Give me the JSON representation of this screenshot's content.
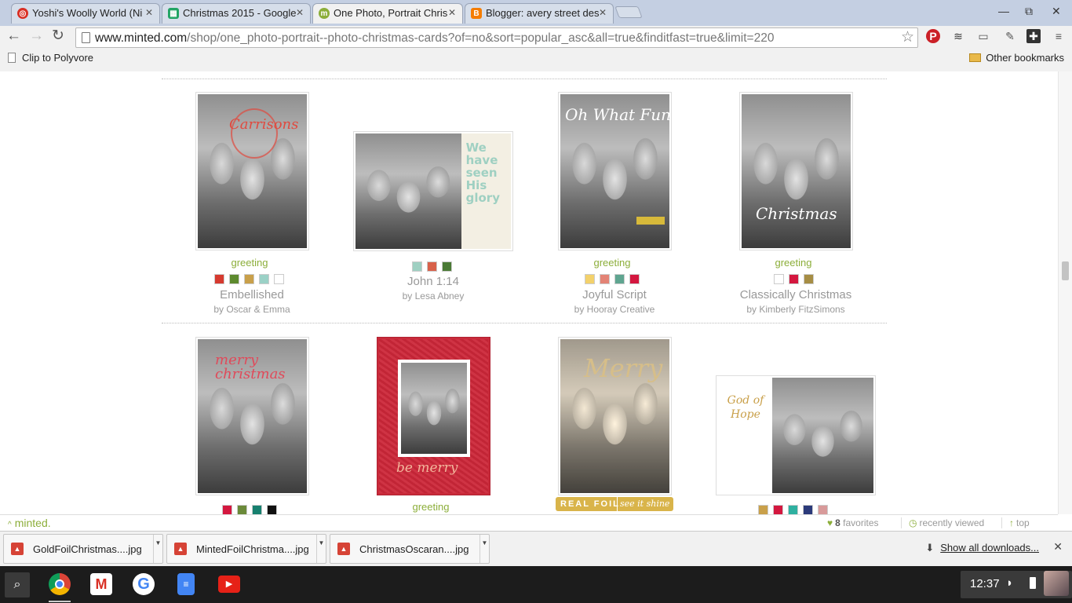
{
  "browser": {
    "tabs": [
      {
        "label": "Yoshi's Woolly World (Ni",
        "favicon_color": "#d93025",
        "favicon": "target-icon"
      },
      {
        "label": "Christmas 2015 - Google",
        "favicon_color": "#21a464",
        "favicon": "sheets-icon"
      },
      {
        "label": "One Photo, Portrait Chris",
        "favicon_color": "#8cae3a",
        "favicon": "minted-icon",
        "active": true
      },
      {
        "label": "Blogger: avery street des",
        "favicon_color": "#f57d00",
        "favicon": "blogger-icon"
      }
    ],
    "url_domain": "www.minted.com",
    "url_path": "/shop/one_photo-portrait--photo-christmas-cards?of=no&sort=popular_asc&all=true&finditfast=true&limit=220",
    "bookmarks": {
      "left": "Clip to Polyvore",
      "right": "Other bookmarks"
    }
  },
  "cards_row1": [
    {
      "label": "greeting",
      "title": "Embellished",
      "by": "by Oscar & Emma",
      "overlay": "Carrisons",
      "overlay_color": "#e04a3f",
      "swatches": [
        "#d63a2f",
        "#5d8a2e",
        "#c9a04a",
        "#9bd1c6",
        "#ffffff"
      ]
    },
    {
      "label": "",
      "title": "John 1:14",
      "by": "by Lesa Abney",
      "overlay": "We have seen His glory",
      "overlay_color": "#e06a55",
      "swatches": [
        "#9fd0c2",
        "#d8614a",
        "#4a7a35"
      ]
    },
    {
      "label": "greeting",
      "title": "Joyful Script",
      "by": "by Hooray Creative",
      "overlay": "Oh What Fun",
      "overlay_color": "#ffffff",
      "swatches": [
        "#f3d16b",
        "#e38375",
        "#5fa590",
        "#d4173f"
      ]
    },
    {
      "label": "greeting",
      "title": "Classically Christmas",
      "by": "by Kimberly FitzSimons",
      "overlay": "Christmas",
      "overlay_color": "#ffffff",
      "swatches": [
        "#ffffff",
        "#d4173f",
        "#a68d44"
      ]
    }
  ],
  "cards_row2": [
    {
      "label": "",
      "overlay": "merry christmas",
      "overlay_color": "#e04a5a",
      "swatches": [
        "#d4173f",
        "#6b8a3a",
        "#17806f",
        "#111111"
      ]
    },
    {
      "label": "greeting",
      "overlay": "be merry",
      "overlay_color": "#f2b59b",
      "swatches": []
    },
    {
      "label": "",
      "overlay": "Merry",
      "overlay_color": "#c9b27a",
      "badge_left": "REAL FOIL",
      "badge_right": "see it shine",
      "swatches": []
    },
    {
      "label": "",
      "overlay": "God of Hope",
      "overlay_color": "#c9a04a",
      "swatches": [
        "#c9a04a",
        "#d4173f",
        "#2fb0a0",
        "#2b3a7a",
        "#d89a9a"
      ]
    }
  ],
  "sitebar": {
    "brand": "minted.",
    "favorites_count": "8",
    "favorites_label": "favorites",
    "recent_label": "recently viewed",
    "top_label": "top"
  },
  "downloads": {
    "items": [
      "GoldFoilChristmas....jpg",
      "MintedFoilChristma....jpg",
      "ChristmasOscaran....jpg"
    ],
    "show_all": "Show all downloads..."
  },
  "shelf": {
    "time": "12:37"
  }
}
